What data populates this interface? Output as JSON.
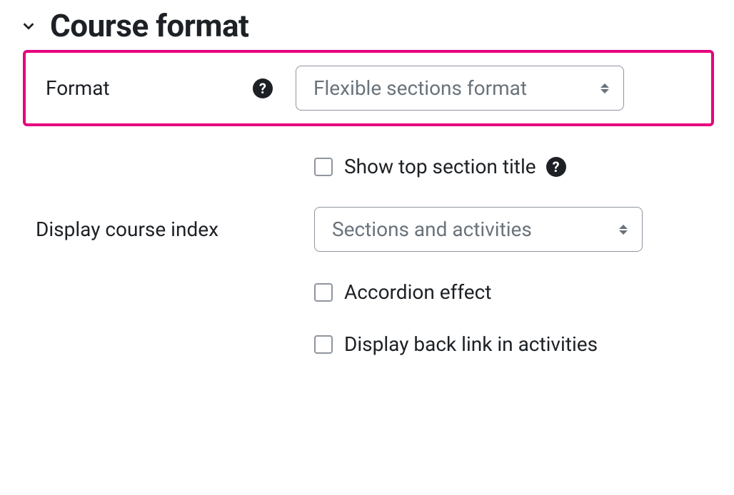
{
  "section": {
    "title": "Course format"
  },
  "fields": {
    "format": {
      "label": "Format",
      "value": "Flexible sections format"
    },
    "show_top_section_title": {
      "label": "Show top section title",
      "checked": false
    },
    "display_course_index": {
      "label": "Display course index",
      "value": "Sections and activities"
    },
    "accordion_effect": {
      "label": "Accordion effect",
      "checked": false
    },
    "display_back_link": {
      "label": "Display back link in activities",
      "checked": false
    }
  },
  "icons": {
    "help": "?"
  }
}
